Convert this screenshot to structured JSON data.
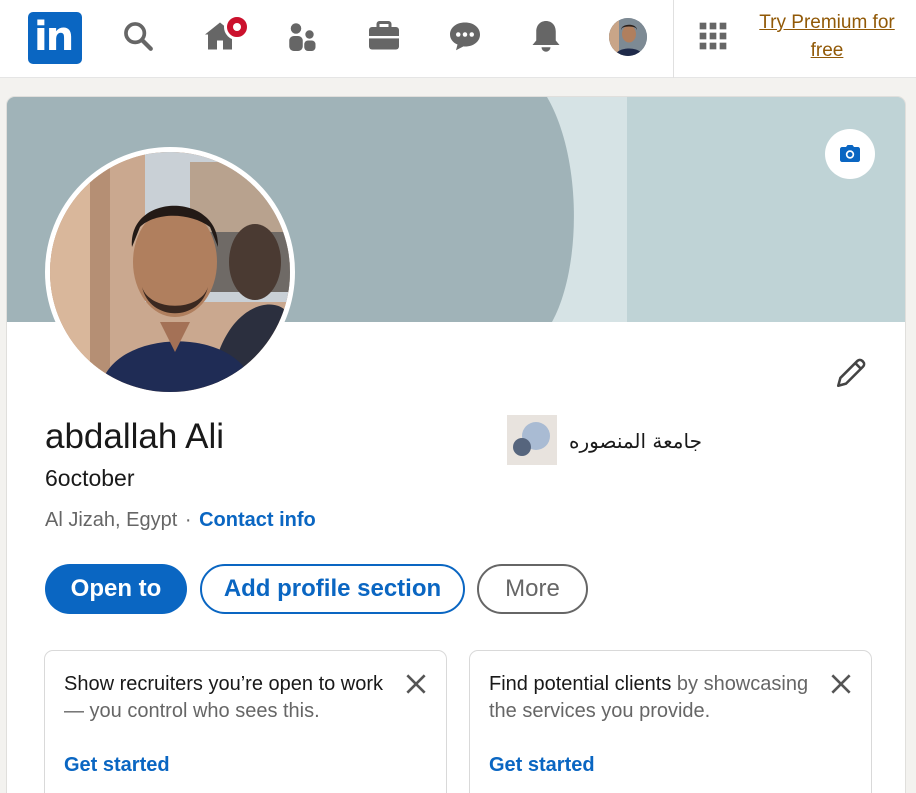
{
  "nav": {
    "logo_text": "in",
    "premium_link": "Try Premium for free",
    "icons": [
      "search-icon",
      "home-icon",
      "my-network-icon",
      "jobs-icon",
      "messaging-icon",
      "notifications-icon",
      "me-avatar",
      "apps-grid-icon"
    ],
    "brand_color": "#0a66c2",
    "notification_color": "#cb112d"
  },
  "profile": {
    "name": "abdallah Ali",
    "headline": "6october",
    "location": "Al Jizah, Egypt",
    "separator": "·",
    "contact_link": "Contact info",
    "education": "جامعة المنصوره"
  },
  "actions": {
    "open_to": "Open to",
    "add_section": "Add profile section",
    "more": "More"
  },
  "tips": [
    {
      "lead": "Show recruiters you’re open to work",
      "rest": " — you control who sees this.",
      "cta": "Get started"
    },
    {
      "lead": "Find potential clients",
      "rest": " by showcasing the services you provide.",
      "cta": "Get started"
    }
  ]
}
